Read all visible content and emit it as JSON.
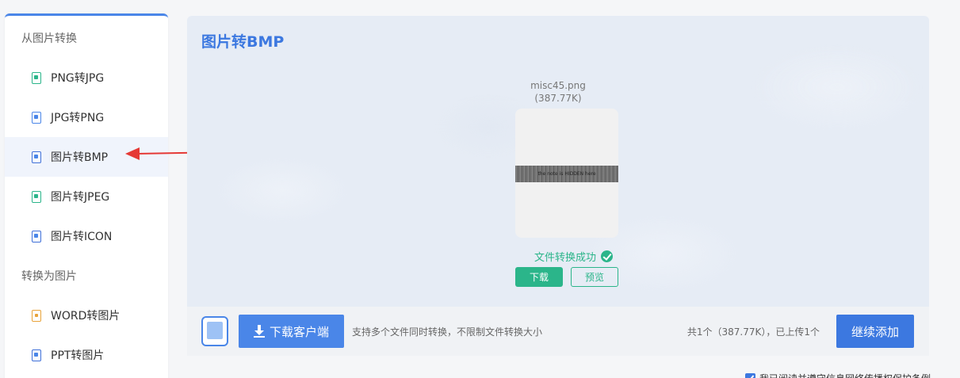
{
  "sidebar": {
    "section1_title": "从图片转换",
    "section2_title": "转换为图片",
    "items": [
      {
        "label": "PNG转JPG",
        "icon": "image-convert-icon"
      },
      {
        "label": "JPG转PNG",
        "icon": "image-convert-icon"
      },
      {
        "label": "图片转BMP",
        "icon": "image-convert-icon",
        "active": true
      },
      {
        "label": "图片转JPEG",
        "icon": "image-convert-icon"
      },
      {
        "label": "图片转ICON",
        "icon": "image-convert-icon"
      },
      {
        "label": "WORD转图片",
        "icon": "word-doc-icon"
      },
      {
        "label": "PPT转图片",
        "icon": "ppt-doc-icon"
      }
    ]
  },
  "main": {
    "title": "图片转BMP",
    "file": {
      "name": "misc45.png",
      "size": "(387.77K)",
      "thumb_text": "the note is HIDDEN here"
    },
    "status": "文件转换成功",
    "download_label": "下载",
    "preview_label": "预览"
  },
  "bottom": {
    "client_button": "下载客户端",
    "hint": "支持多个文件同时转换，不限制文件转换大小",
    "summary": "共1个（387.77K），已上传1个",
    "add_button": "继续添加"
  },
  "agreement": "我已阅读并遵守信息网络传播权保护条例",
  "colors": {
    "accent": "#3c78e0",
    "success": "#2bb58a",
    "annotation_arrow": "#e53935"
  }
}
